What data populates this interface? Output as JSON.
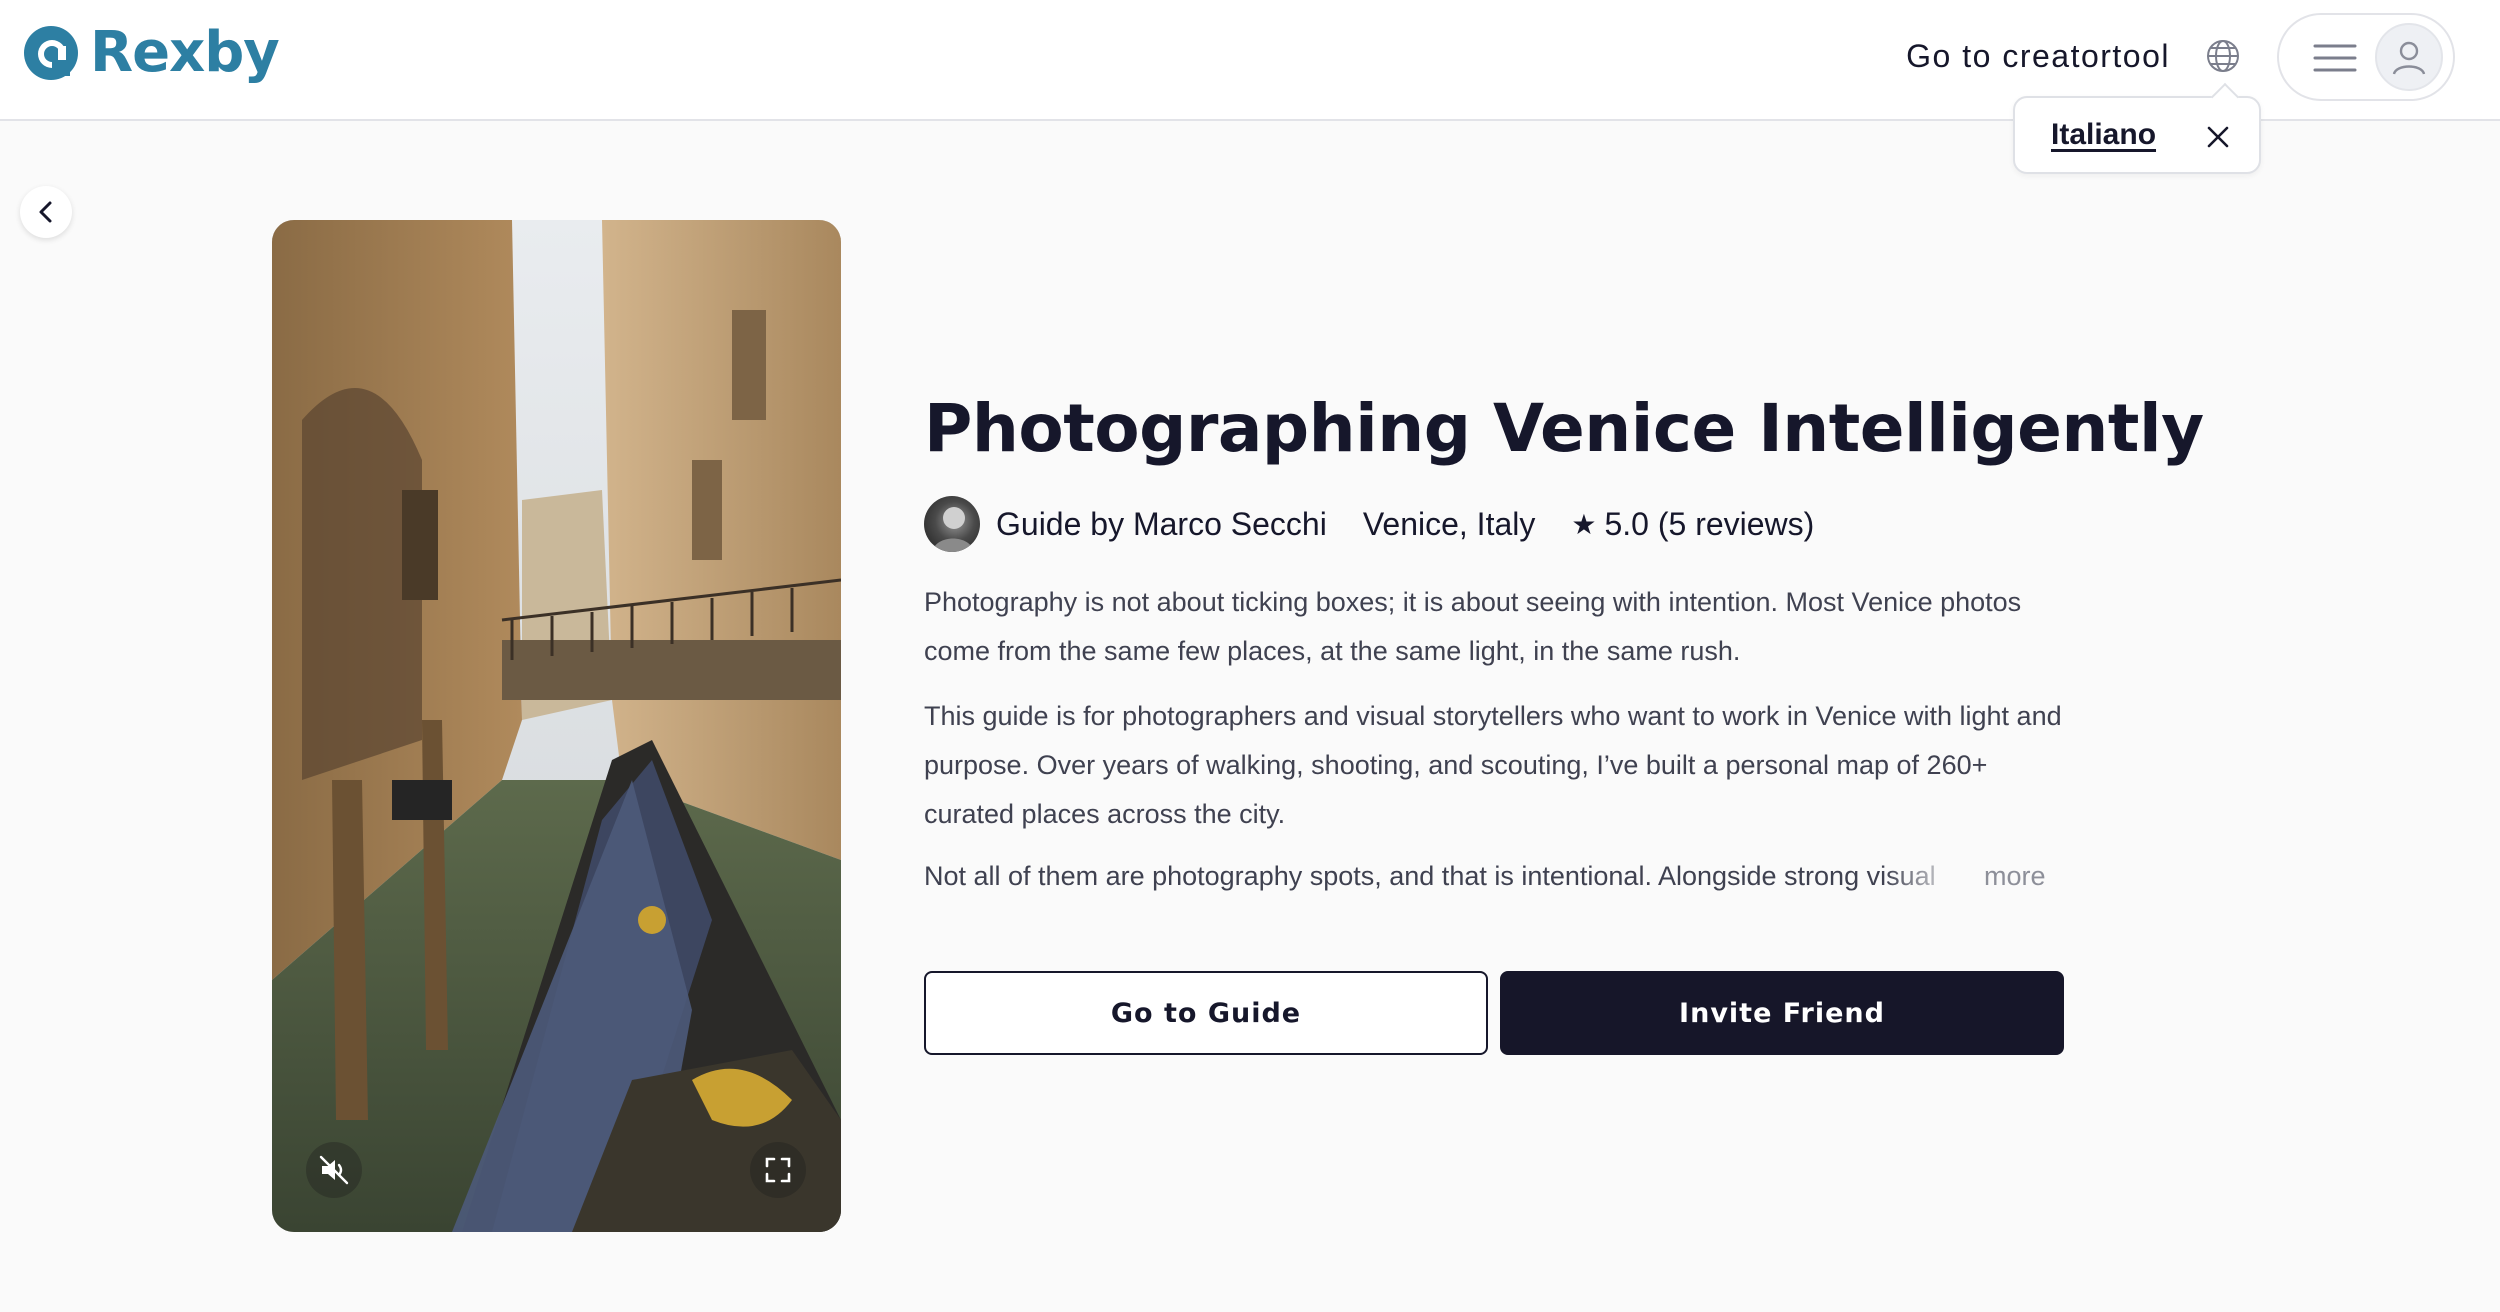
{
  "header": {
    "brand": "Rexby",
    "creator_link": "Go to creatortool",
    "icons": {
      "globe": "globe-icon",
      "menu": "hamburger-menu-icon",
      "user": "user-avatar-icon"
    }
  },
  "language_popover": {
    "option": "Italiano",
    "close_icon": "close-icon"
  },
  "navigation": {
    "back_icon": "chevron-left-icon"
  },
  "video": {
    "mute_icon": "speaker-muted-icon",
    "fullscreen_icon": "fullscreen-icon"
  },
  "guide": {
    "title": "Photographing Venice Intelligently",
    "author": "Guide by Marco Secchi",
    "location": "Venice, Italy",
    "rating": "5.0 (5 reviews)",
    "star": "★",
    "description": [
      "Photography is not about ticking boxes; it is about seeing with intention. Most Venice photos come from the same few places, at the same light, in the same rush.",
      "This guide is for photographers and visual storytellers who want to work in Venice with light and purpose. Over years of walking, shooting, and scouting, I’ve built a personal map of 260+ curated places across the city.",
      "Not all of them are photography spots, and that is intentional. Alongside strong visual"
    ],
    "more_label": "more",
    "go_to_guide": "Go to Guide",
    "invite_friend": "Invite Friend"
  },
  "colors": {
    "brand": "#2d7fa3",
    "primary_button": "#161629",
    "text": "#16172b",
    "background": "#fafafa"
  }
}
